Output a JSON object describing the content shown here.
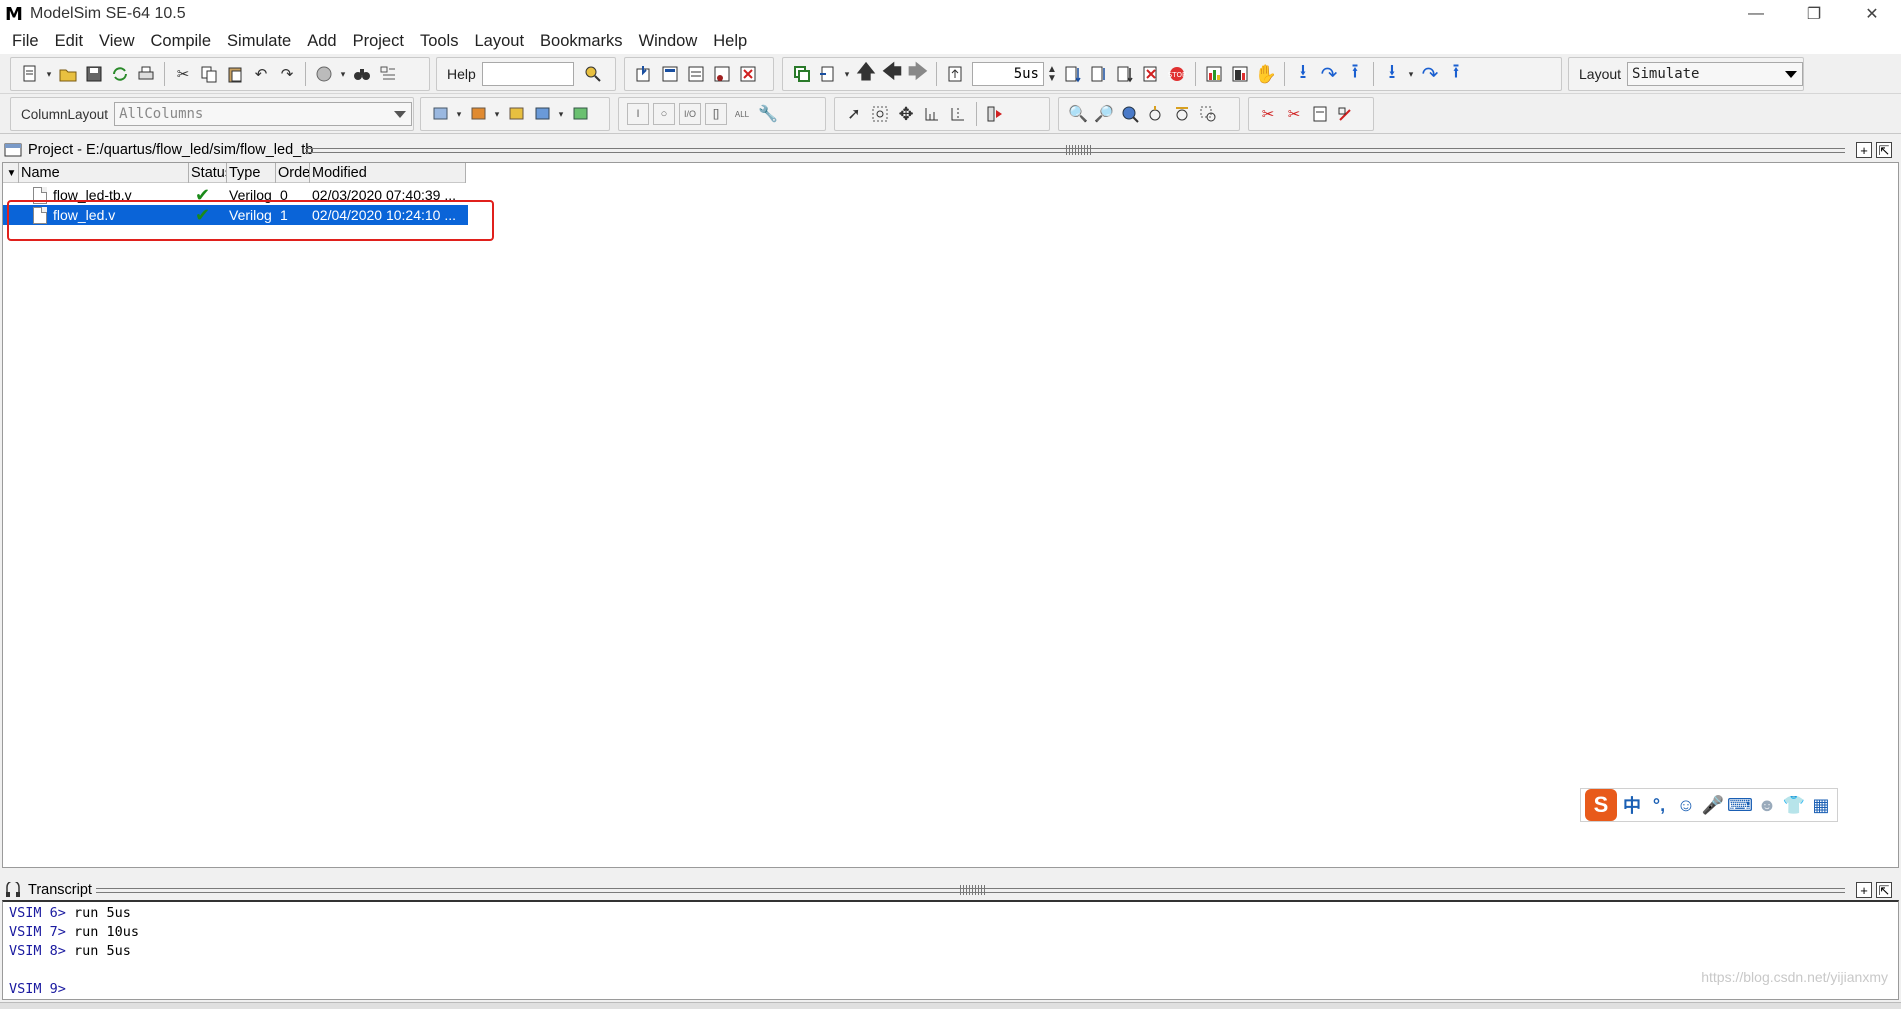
{
  "window": {
    "title": "ModelSim SE-64 10.5",
    "logo_letter": "M",
    "minimize": "—",
    "restore": "❐",
    "close": "✕"
  },
  "menu": [
    "File",
    "Edit",
    "View",
    "Compile",
    "Simulate",
    "Add",
    "Project",
    "Tools",
    "Layout",
    "Bookmarks",
    "Window",
    "Help"
  ],
  "toolbar": {
    "help_label": "Help",
    "help_value": "",
    "run_length": "5us",
    "layout_label": "Layout",
    "layout_value": "Simulate",
    "column_layout_label": "ColumnLayout",
    "column_layout_value": "AllColumns"
  },
  "project_pane": {
    "title": "Project - E:/quartus/flow_led/sim/flow_led_tb",
    "columns": [
      "Name",
      "Status",
      "Type",
      "Order",
      "Modified"
    ],
    "files": [
      {
        "name": "flow_led-tb.v",
        "status": "✔",
        "type": "Verilog",
        "order": "0",
        "modified": "02/03/2020 07:40:39 ..."
      },
      {
        "name": "flow_led.v",
        "status": "✔",
        "type": "Verilog",
        "order": "1",
        "modified": "02/04/2020 10:24:10 ..."
      }
    ]
  },
  "ime": {
    "logo": "S",
    "lang": "中",
    "punct": "°,",
    "emoji": "☺",
    "mic": "🎤",
    "keyboard": "⌨",
    "user": "☻",
    "skin": "👕",
    "grid": "▦"
  },
  "transcript": {
    "title": "Transcript",
    "lines": [
      {
        "prompt": "VSIM 6>",
        "cmd": " run 5us"
      },
      {
        "prompt": "VSIM 7>",
        "cmd": " run 10us"
      },
      {
        "prompt": "VSIM 8>",
        "cmd": " run 5us"
      },
      {
        "prompt": "",
        "cmd": ""
      },
      {
        "prompt": "VSIM 9>",
        "cmd": ""
      }
    ],
    "watermark": "https://blog.csdn.net/yijianxmy"
  },
  "colors": {
    "selection": "#0a64d8",
    "highlight_box": "#e0201c",
    "prompt": "#1a1aa0"
  }
}
